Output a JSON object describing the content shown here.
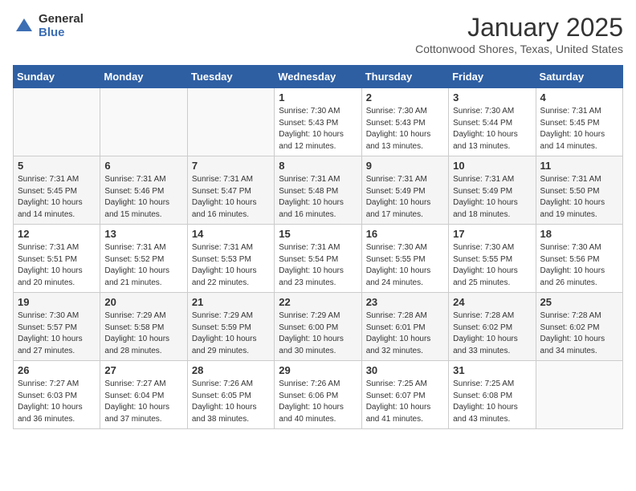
{
  "logo": {
    "general": "General",
    "blue": "Blue"
  },
  "title": "January 2025",
  "subtitle": "Cottonwood Shores, Texas, United States",
  "weekdays": [
    "Sunday",
    "Monday",
    "Tuesday",
    "Wednesday",
    "Thursday",
    "Friday",
    "Saturday"
  ],
  "weeks": [
    [
      {
        "day": "",
        "info": ""
      },
      {
        "day": "",
        "info": ""
      },
      {
        "day": "",
        "info": ""
      },
      {
        "day": "1",
        "info": "Sunrise: 7:30 AM\nSunset: 5:43 PM\nDaylight: 10 hours\nand 12 minutes."
      },
      {
        "day": "2",
        "info": "Sunrise: 7:30 AM\nSunset: 5:43 PM\nDaylight: 10 hours\nand 13 minutes."
      },
      {
        "day": "3",
        "info": "Sunrise: 7:30 AM\nSunset: 5:44 PM\nDaylight: 10 hours\nand 13 minutes."
      },
      {
        "day": "4",
        "info": "Sunrise: 7:31 AM\nSunset: 5:45 PM\nDaylight: 10 hours\nand 14 minutes."
      }
    ],
    [
      {
        "day": "5",
        "info": "Sunrise: 7:31 AM\nSunset: 5:45 PM\nDaylight: 10 hours\nand 14 minutes."
      },
      {
        "day": "6",
        "info": "Sunrise: 7:31 AM\nSunset: 5:46 PM\nDaylight: 10 hours\nand 15 minutes."
      },
      {
        "day": "7",
        "info": "Sunrise: 7:31 AM\nSunset: 5:47 PM\nDaylight: 10 hours\nand 16 minutes."
      },
      {
        "day": "8",
        "info": "Sunrise: 7:31 AM\nSunset: 5:48 PM\nDaylight: 10 hours\nand 16 minutes."
      },
      {
        "day": "9",
        "info": "Sunrise: 7:31 AM\nSunset: 5:49 PM\nDaylight: 10 hours\nand 17 minutes."
      },
      {
        "day": "10",
        "info": "Sunrise: 7:31 AM\nSunset: 5:49 PM\nDaylight: 10 hours\nand 18 minutes."
      },
      {
        "day": "11",
        "info": "Sunrise: 7:31 AM\nSunset: 5:50 PM\nDaylight: 10 hours\nand 19 minutes."
      }
    ],
    [
      {
        "day": "12",
        "info": "Sunrise: 7:31 AM\nSunset: 5:51 PM\nDaylight: 10 hours\nand 20 minutes."
      },
      {
        "day": "13",
        "info": "Sunrise: 7:31 AM\nSunset: 5:52 PM\nDaylight: 10 hours\nand 21 minutes."
      },
      {
        "day": "14",
        "info": "Sunrise: 7:31 AM\nSunset: 5:53 PM\nDaylight: 10 hours\nand 22 minutes."
      },
      {
        "day": "15",
        "info": "Sunrise: 7:31 AM\nSunset: 5:54 PM\nDaylight: 10 hours\nand 23 minutes."
      },
      {
        "day": "16",
        "info": "Sunrise: 7:30 AM\nSunset: 5:55 PM\nDaylight: 10 hours\nand 24 minutes."
      },
      {
        "day": "17",
        "info": "Sunrise: 7:30 AM\nSunset: 5:55 PM\nDaylight: 10 hours\nand 25 minutes."
      },
      {
        "day": "18",
        "info": "Sunrise: 7:30 AM\nSunset: 5:56 PM\nDaylight: 10 hours\nand 26 minutes."
      }
    ],
    [
      {
        "day": "19",
        "info": "Sunrise: 7:30 AM\nSunset: 5:57 PM\nDaylight: 10 hours\nand 27 minutes."
      },
      {
        "day": "20",
        "info": "Sunrise: 7:29 AM\nSunset: 5:58 PM\nDaylight: 10 hours\nand 28 minutes."
      },
      {
        "day": "21",
        "info": "Sunrise: 7:29 AM\nSunset: 5:59 PM\nDaylight: 10 hours\nand 29 minutes."
      },
      {
        "day": "22",
        "info": "Sunrise: 7:29 AM\nSunset: 6:00 PM\nDaylight: 10 hours\nand 30 minutes."
      },
      {
        "day": "23",
        "info": "Sunrise: 7:28 AM\nSunset: 6:01 PM\nDaylight: 10 hours\nand 32 minutes."
      },
      {
        "day": "24",
        "info": "Sunrise: 7:28 AM\nSunset: 6:02 PM\nDaylight: 10 hours\nand 33 minutes."
      },
      {
        "day": "25",
        "info": "Sunrise: 7:28 AM\nSunset: 6:02 PM\nDaylight: 10 hours\nand 34 minutes."
      }
    ],
    [
      {
        "day": "26",
        "info": "Sunrise: 7:27 AM\nSunset: 6:03 PM\nDaylight: 10 hours\nand 36 minutes."
      },
      {
        "day": "27",
        "info": "Sunrise: 7:27 AM\nSunset: 6:04 PM\nDaylight: 10 hours\nand 37 minutes."
      },
      {
        "day": "28",
        "info": "Sunrise: 7:26 AM\nSunset: 6:05 PM\nDaylight: 10 hours\nand 38 minutes."
      },
      {
        "day": "29",
        "info": "Sunrise: 7:26 AM\nSunset: 6:06 PM\nDaylight: 10 hours\nand 40 minutes."
      },
      {
        "day": "30",
        "info": "Sunrise: 7:25 AM\nSunset: 6:07 PM\nDaylight: 10 hours\nand 41 minutes."
      },
      {
        "day": "31",
        "info": "Sunrise: 7:25 AM\nSunset: 6:08 PM\nDaylight: 10 hours\nand 43 minutes."
      },
      {
        "day": "",
        "info": ""
      }
    ]
  ]
}
